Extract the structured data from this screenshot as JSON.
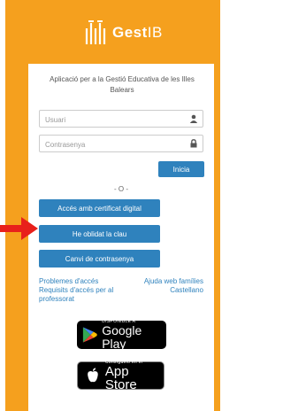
{
  "brand": {
    "logo_bold": "Gest",
    "logo_thin": "IB",
    "orange": "#f5a01e",
    "blue": "#2f82bd"
  },
  "login": {
    "intro": "Aplicació per a la Gestió Educativa de les Illes Balears",
    "username_placeholder": "Usuari",
    "password_placeholder": "Contrasenya",
    "submit_label": "Inicia",
    "separator": "- O -",
    "cert_button": "Accés amb certificat digital",
    "forgot_button": "He oblidat la clau",
    "change_password_button": "Canvi de contrasenya"
  },
  "links": {
    "access_problems": "Problemes d'accés",
    "access_requirements_line1": "Requisits d'accés per al",
    "access_requirements_line2": "professorat",
    "families_web": "Ajuda web famílies",
    "language": "Castellano"
  },
  "stores": {
    "google_small": "DISPONIBLE A",
    "google_big": "Google Play",
    "apple_small": "Consíguelo en el",
    "apple_big": "App Store"
  },
  "annotation": {
    "arrow_color": "#e8201b",
    "arrow_target": "forgot-password-button"
  }
}
